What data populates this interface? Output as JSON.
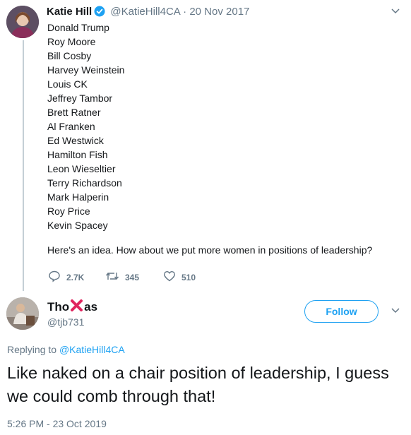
{
  "tweet1": {
    "name": "Katie Hill",
    "handle": "@KatieHill4CA",
    "date": "20 Nov 2017",
    "separator": "·",
    "names_list": [
      "Donald Trump",
      "Roy Moore",
      "Bill Cosby",
      "Harvey Weinstein",
      "Louis CK",
      "Jeffrey Tambor",
      "Brett Ratner",
      "Al Franken",
      "Ed Westwick",
      "Hamilton Fish",
      "Leon Wieseltier",
      "Terry Richardson",
      "Mark Halperin",
      "Roy Price",
      "Kevin Spacey"
    ],
    "text": "Here's an idea. How about we put more women in positions of leadership?",
    "replies": "2.7K",
    "retweets": "345",
    "likes": "510"
  },
  "tweet2": {
    "name_part1": "Tho",
    "name_part2": "as",
    "handle": "@tjb731",
    "follow_label": "Follow",
    "replying_prefix": "Replying to",
    "replying_to": "@KatieHill4CA",
    "text": "Like naked on a chair position of leadership, I guess we could comb through that!",
    "timestamp": "5:26 PM - 23 Oct 2019"
  },
  "icons": {
    "verified": "verified-badge-icon",
    "reply": "reply-icon",
    "retweet": "retweet-icon",
    "like": "heart-icon",
    "menu": "chevron-down-icon",
    "cross": "red-x-emoji-icon"
  },
  "colors": {
    "accent": "#1da1f2",
    "muted": "#657786",
    "text": "#14171a",
    "cross": "#e0245e"
  }
}
